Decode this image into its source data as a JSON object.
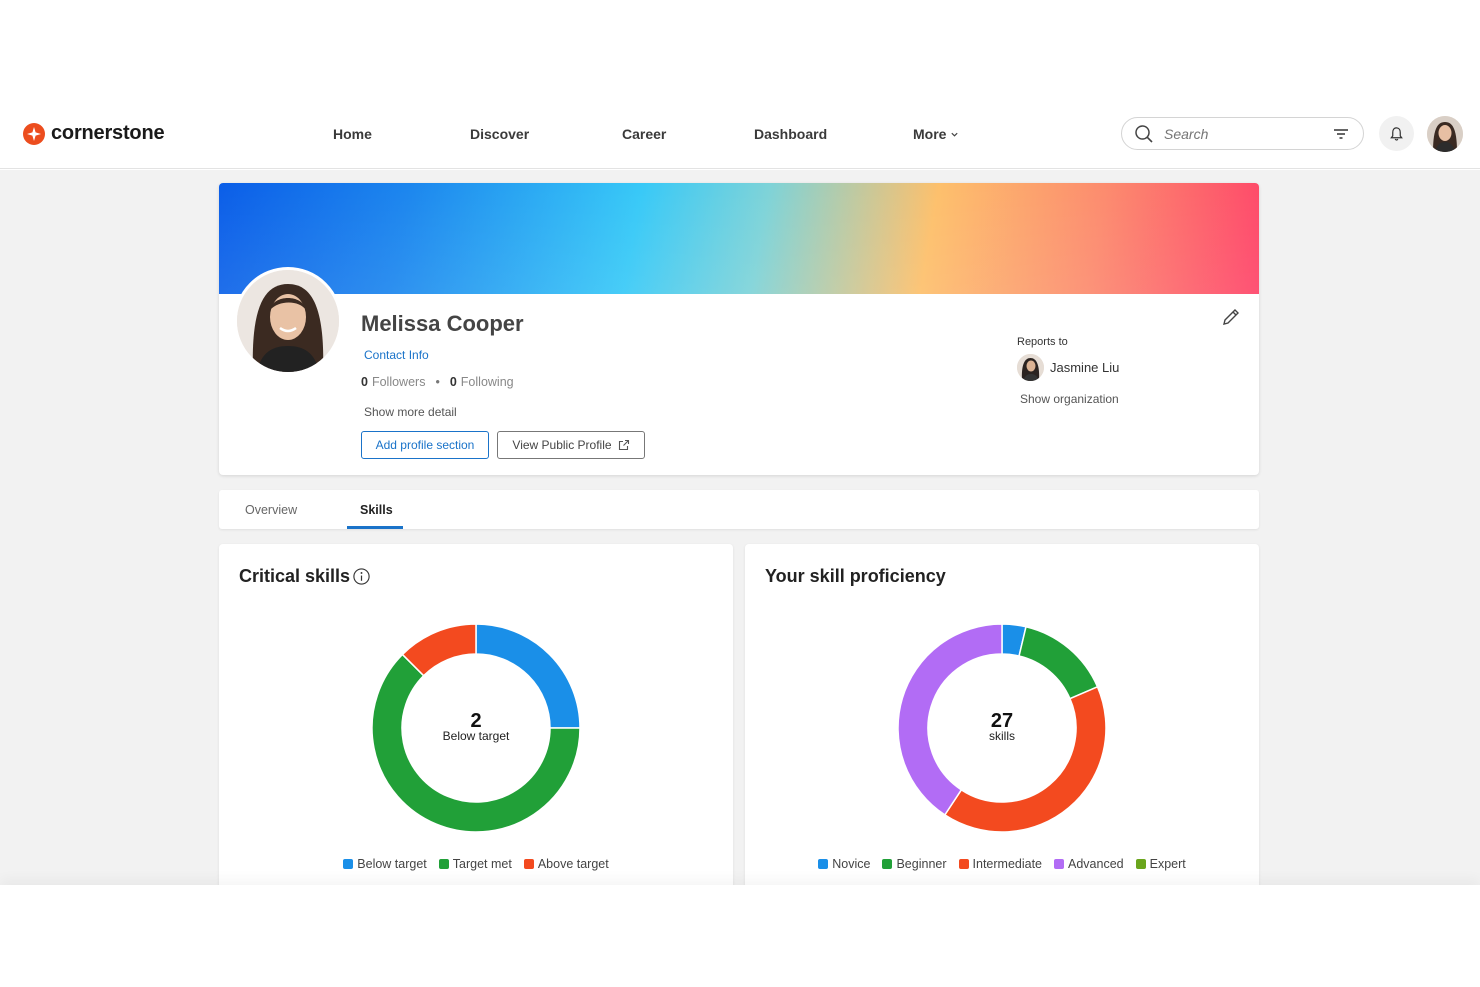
{
  "brand": {
    "name": "cornerstone",
    "color": "#ec4d1e"
  },
  "nav": {
    "home": "Home",
    "discover": "Discover",
    "career": "Career",
    "dashboard": "Dashboard",
    "more": "More"
  },
  "search": {
    "placeholder": "Search"
  },
  "profile": {
    "name": "Melissa Cooper",
    "contact_info": "Contact Info",
    "followers_count": "0",
    "followers_label": "Followers",
    "following_count": "0",
    "following_label": "Following",
    "show_more": "Show more detail",
    "add_section": "Add profile section",
    "view_public": "View Public Profile",
    "reports_to_label": "Reports to",
    "manager_name": "Jasmine Liu",
    "show_org": "Show organization"
  },
  "tabs": [
    {
      "label": "Overview",
      "active": false
    },
    {
      "label": "Skills",
      "active": true
    }
  ],
  "critical_skills": {
    "title": "Critical skills",
    "center_value": "2",
    "center_label": "Below target",
    "legend": [
      {
        "label": "Below target",
        "color": "#1a8fe8"
      },
      {
        "label": "Target met",
        "color": "#21a038"
      },
      {
        "label": "Above target",
        "color": "#f34a1f"
      }
    ]
  },
  "proficiency": {
    "title": "Your skill proficiency",
    "center_value": "27",
    "center_label": "skills",
    "legend": [
      {
        "label": "Novice",
        "color": "#1a8fe8"
      },
      {
        "label": "Beginner",
        "color": "#21a038"
      },
      {
        "label": "Intermediate",
        "color": "#f34a1f"
      },
      {
        "label": "Advanced",
        "color": "#b26cf5"
      },
      {
        "label": "Expert",
        "color": "#6aa51c"
      }
    ]
  },
  "chart_data": [
    {
      "type": "pie",
      "title": "Critical skills",
      "categories": [
        "Below target",
        "Target met",
        "Above target"
      ],
      "values": [
        2,
        5,
        1
      ]
    },
    {
      "type": "pie",
      "title": "Your skill proficiency",
      "categories": [
        "Novice",
        "Beginner",
        "Intermediate",
        "Advanced",
        "Expert"
      ],
      "values": [
        1,
        4,
        11,
        11,
        0
      ]
    }
  ]
}
